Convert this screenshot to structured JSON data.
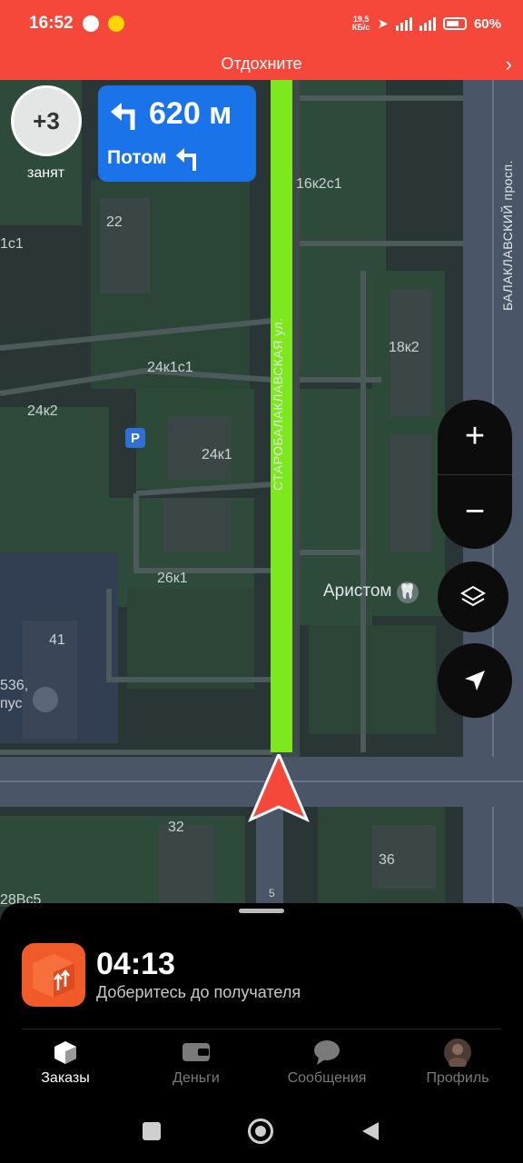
{
  "status": {
    "time": "16:52",
    "net_speed": "19,5\nКБ/с",
    "battery": "60%"
  },
  "banner": {
    "text": "Отдохните"
  },
  "map": {
    "street_name": "СТАРОБАЛАКЛАВСКАЯ ул.",
    "avenue_name": "БАЛАКЛАВСКИЙ просп.",
    "labels": [
      "16к2с1",
      "22",
      "24к1с1",
      "24к2",
      "24к1",
      "26к1",
      "41",
      "18к2",
      "32",
      "36",
      "28Вс5",
      "1с1",
      "536,",
      "пус",
      "5"
    ],
    "poi_name": "Аристом",
    "parking": "P"
  },
  "navigation": {
    "speed_badge": "+3",
    "speed_caption": "занят",
    "distance": "620 м",
    "then_label": "Потом"
  },
  "controls": {
    "zoom_in": "+",
    "zoom_out": "−"
  },
  "order": {
    "time": "04:13",
    "subtitle": "Доберитесь до получателя"
  },
  "tabs": [
    {
      "label": "Заказы",
      "icon": "box-icon",
      "active": true
    },
    {
      "label": "Деньги",
      "icon": "wallet-icon",
      "active": false
    },
    {
      "label": "Сообщения",
      "icon": "chat-icon",
      "active": false
    },
    {
      "label": "Профиль",
      "icon": "avatar",
      "active": false
    }
  ],
  "colors": {
    "accent": "#f5483a",
    "route": "#7ee81e",
    "maneuver": "#1a73e8",
    "order_icon": "#f15a29"
  }
}
